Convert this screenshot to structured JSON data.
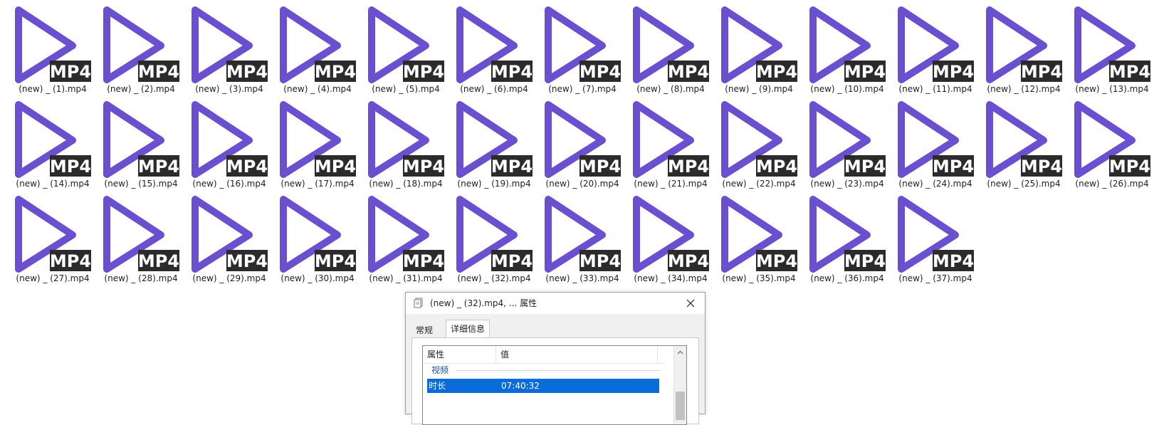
{
  "files": [
    "(new) _ (1).mp4",
    "(new) _ (2).mp4",
    "(new) _ (3).mp4",
    "(new) _ (4).mp4",
    "(new) _ (5).mp4",
    "(new) _ (6).mp4",
    "(new) _ (7).mp4",
    "(new) _ (8).mp4",
    "(new) _ (9).mp4",
    "(new) _ (10).mp4",
    "(new) _ (11).mp4",
    "(new) _ (12).mp4",
    "(new) _ (13).mp4",
    "(new) _ (14).mp4",
    "(new) _ (15).mp4",
    "(new) _ (16).mp4",
    "(new) _ (17).mp4",
    "(new) _ (18).mp4",
    "(new) _ (19).mp4",
    "(new) _ (20).mp4",
    "(new) _ (21).mp4",
    "(new) _ (22).mp4",
    "(new) _ (23).mp4",
    "(new) _ (24).mp4",
    "(new) _ (25).mp4",
    "(new) _ (26).mp4",
    "(new) _ (27).mp4",
    "(new) _ (28).mp4",
    "(new) _ (29).mp4",
    "(new) _ (30).mp4",
    "(new) _ (31).mp4",
    "(new) _ (32).mp4",
    "(new) _ (33).mp4",
    "(new) _ (34).mp4",
    "(new) _ (35).mp4",
    "(new) _ (36).mp4",
    "(new) _ (37).mp4"
  ],
  "icon": {
    "name": "mp4-play-icon",
    "badge_text": "MP4",
    "play_color": "#6a4fcf",
    "badge_color": "#2b2b2b"
  },
  "dialog": {
    "title": "(new) _ (32).mp4, ... 属性",
    "close_icon": "close-icon",
    "tabs": {
      "general": "常规",
      "details": "详细信息"
    },
    "list": {
      "col_property": "属性",
      "col_value": "值",
      "group": "视频",
      "selected_row": {
        "label": "时长",
        "value": "07:40:32"
      }
    },
    "selection_color": "#0a6cd8"
  }
}
